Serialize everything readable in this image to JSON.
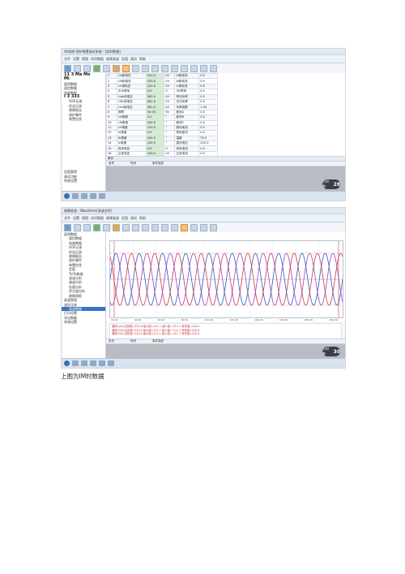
{
  "screenshot1": {
    "title": "XX测控 保护装置调试系统 - [实时数据]",
    "ribbon_tabs": [
      "文件",
      "设置",
      "视图",
      "实时数据",
      "故障录波",
      "定值",
      "调试",
      "帮助"
    ],
    "tree_header": [
      "11 3 Ma",
      "Mo",
      "Mi"
    ],
    "tree_items": [
      "I 3 333",
      "遥测数据",
      "遥信数据",
      "电度数据",
      "SOE记录",
      "扰动记录",
      "故障报告",
      "保护事件",
      "装置信息"
    ],
    "tree_bottom": [
      "定值管理",
      "调试功能",
      "系统设置"
    ],
    "table_rows": [
      [
        "1",
        "Ua相电压",
        "220.0",
        "kV",
        "Ia相电流",
        "0.0"
      ],
      [
        "2",
        "Ub相电压",
        "220.0",
        "kV",
        "Ib相电流",
        "0.0"
      ],
      [
        "3",
        "Uc相电压",
        "220.0",
        "kV",
        "Ic相电流",
        "0.0"
      ],
      [
        "4",
        "3U0零序",
        "0.0",
        "V",
        "3I0零序",
        "0.0"
      ],
      [
        "5",
        "Uab线电压",
        "381.0",
        "kV",
        "有功功率",
        "0.0"
      ],
      [
        "6",
        "Ubc线电压",
        "381.0",
        "kV",
        "无功功率",
        "0.0"
      ],
      [
        "7",
        "Uca线电压",
        "381.0",
        "kV",
        "功率因数",
        "1.00"
      ],
      [
        "8",
        "频率",
        "50.00",
        "Hz",
        "差流A",
        "0.0"
      ],
      [
        "9",
        "Ua角度",
        "0.0",
        "°",
        "差流B",
        "0.0"
      ],
      [
        "10",
        "Ub角度",
        "240.0",
        "°",
        "差流C",
        "0.0"
      ],
      [
        "11",
        "Uc角度",
        "120.0",
        "°",
        "制动电流",
        "0.0"
      ],
      [
        "12",
        "Ia角度",
        "0.0",
        "°",
        "零序差流",
        "0.0"
      ],
      [
        "13",
        "Ib角度",
        "240.0",
        "°",
        "温度",
        "35.0"
      ],
      [
        "14",
        "Ic角度",
        "120.0",
        "°",
        "直流电压",
        "220.0"
      ],
      [
        "15",
        "负序电压",
        "0.0",
        "V",
        "负序电流",
        "0.0"
      ],
      [
        "16",
        "正序电压",
        "220.0",
        "kV",
        "正序电流",
        "0.0"
      ],
      [
        "17",
        "Mi时间",
        "0",
        "",
        "",
        ""
      ],
      [
        "18",
        "Mi/Mo",
        "",
        "",
        "",
        ""
      ]
    ],
    "lower_panel_title": "事件",
    "lower_cols": [
      "序号",
      "时间",
      "事件描述"
    ],
    "badge_label": "小时数",
    "badge_value": "28"
  },
  "screenshot2": {
    "title": "故障录波 - Waveform[录波文件]",
    "tree_items": [
      "遥测数据",
      "遥信数据",
      "电度数据",
      "SOE记录",
      "扰动记录",
      "故障报告",
      "保护事件",
      "装置信息",
      "定值",
      "Ts/Ta数据",
      "录波分析",
      "谐波分析",
      "矢量分析",
      "序分量分析",
      "故障测距",
      "录波管理",
      "波形比较",
      "打印设置",
      "导出数据",
      "系统设置"
    ],
    "tree_sel": "录波数据",
    "axis_ticks": [
      "20.00",
      "40.00",
      "60.00",
      "80.00",
      "100.00",
      "120.00",
      "140.00",
      "160.00",
      "180.00",
      "200.00"
    ],
    "legend_lines": [
      "通道1(Ua)当前值=220.0 最大值=311.1 最小值=-311.1 有效值=220.0",
      "通道2(Ub)当前值=220.0 最大值=311.1 最小值=-311.1 有效值=220.0",
      "通道3(Uc)当前值=220.0 最大值=311.1 最小值=-311.1 有效值=220.0",
      "通道4(Ia)当前值=0.0 最大值=0.0 最小值=0.0 有效值=0.0"
    ],
    "lower_cols": [
      "序号",
      "时间",
      "事件描述"
    ],
    "badge_label": "小时数",
    "badge_value": "30"
  },
  "caption": "上图为IM时数据"
}
